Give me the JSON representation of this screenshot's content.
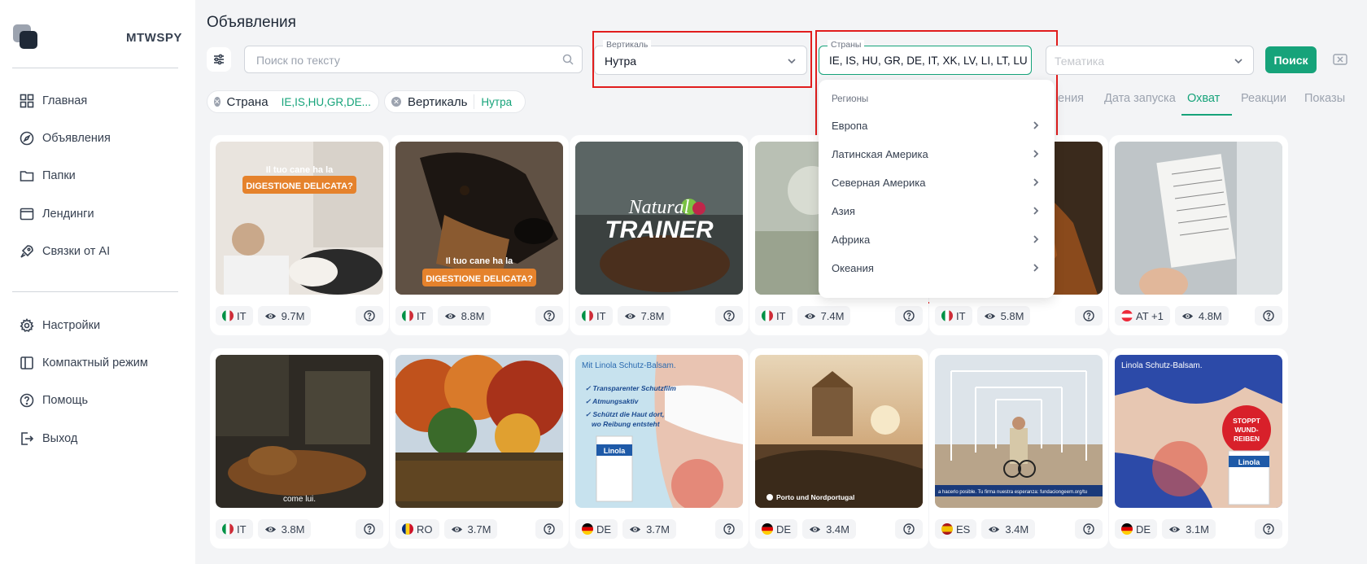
{
  "sidebar": {
    "brand": "MTWSPY",
    "items": [
      {
        "label": "Главная",
        "icon": "grid-icon"
      },
      {
        "label": "Объявления",
        "icon": "compass-icon"
      },
      {
        "label": "Папки",
        "icon": "folder-icon"
      },
      {
        "label": "Лендинги",
        "icon": "browser-icon"
      },
      {
        "label": "Связки от AI",
        "icon": "rocket-icon"
      }
    ],
    "items2": [
      {
        "label": "Настройки",
        "icon": "gear-icon"
      },
      {
        "label": "Компактный режим",
        "icon": "layout-icon"
      },
      {
        "label": "Помощь",
        "icon": "help-icon"
      },
      {
        "label": "Выход",
        "icon": "logout-icon"
      }
    ]
  },
  "main": {
    "title": "Объявления",
    "search_placeholder": "Поиск по тексту",
    "vertical": {
      "label": "Вертикаль",
      "value": "Нутра"
    },
    "countries": {
      "label": "Страны",
      "value": "IE, IS, HU, GR, DE, IT, XK, LV, LI, LT, LU, I"
    },
    "theme_placeholder": "Тематика",
    "search_button": "Поиск"
  },
  "chips": [
    {
      "name": "Страна",
      "value": "IE,IS,HU,GR,DE..."
    },
    {
      "name": "Вертикаль",
      "value": "Нутра"
    }
  ],
  "sort_tabs": [
    "ения",
    "Дата запуска",
    "Охват",
    "Реакции",
    "Показы"
  ],
  "active_tab": "Охват",
  "dropdown": {
    "header": "Регионы",
    "items": [
      "Европа",
      "Латинская Америка",
      "Северная Америка",
      "Азия",
      "Африка",
      "Океания"
    ]
  },
  "cards": [
    {
      "country": "IT",
      "views": "9.7M",
      "flag": "it"
    },
    {
      "country": "IT",
      "views": "8.8M",
      "flag": "it"
    },
    {
      "country": "IT",
      "views": "7.8M",
      "flag": "it"
    },
    {
      "country": "IT",
      "views": "7.4M",
      "flag": "it"
    },
    {
      "country": "IT",
      "views": "5.8M",
      "flag": "it"
    },
    {
      "country": "AT +1",
      "views": "4.8M",
      "flag": "at"
    },
    {
      "country": "IT",
      "views": "3.8M",
      "flag": "it"
    },
    {
      "country": "RO",
      "views": "3.7M",
      "flag": "ro"
    },
    {
      "country": "DE",
      "views": "3.7M",
      "flag": "de"
    },
    {
      "country": "DE",
      "views": "3.4M",
      "flag": "de"
    },
    {
      "country": "ES",
      "views": "3.4M",
      "flag": "es"
    },
    {
      "country": "DE",
      "views": "3.1M",
      "flag": "de"
    }
  ],
  "thumb_text": {
    "c1_top": "Il tuo cane ha la",
    "c1_tag": "DIGESTIONE DELICATA?",
    "c2_top": "Il tuo cane ha la",
    "c2_tag": "DIGESTIONE DELICATA?",
    "c3_logo1": "Natural",
    "c3_logo2": "TRAINER",
    "c7_caption": "come lui.",
    "c9_title": "Mit Linola Schutz-Balsam.",
    "c9_b1": "Transparenter Schutzfilm",
    "c9_b2": "Atmungsaktiv",
    "c9_b3": "Schützt die Haut dort, wo Reibung entsteht",
    "c9_brand": "Linola",
    "c10_caption": "Porto und Nordportugal",
    "c11_caption": "a hacerlo posible. Tu firma nuestra esperanza: fundaciongeem.org/tu",
    "c12_title": "Linola Schutz-Balsam.",
    "c12_badge": "STOPPT WUND-REIBEN",
    "c12_brand": "Linola"
  }
}
